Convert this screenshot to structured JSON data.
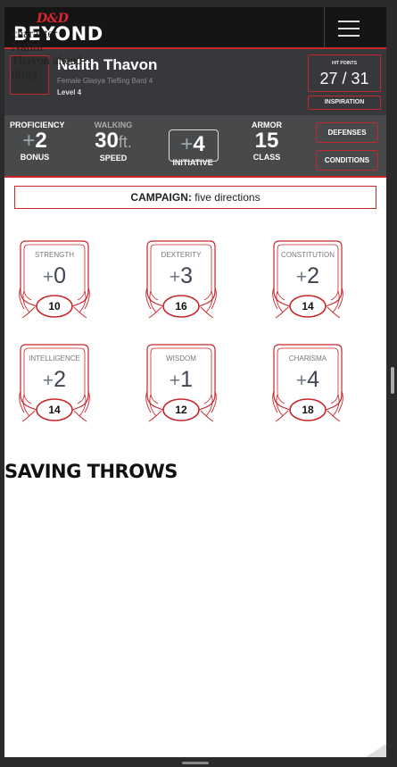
{
  "brand": {
    "logo_top": "D&D",
    "logo_bottom": "BEYOND"
  },
  "menu": {
    "icon": "hamburger-menu-icon"
  },
  "character": {
    "avatar_alt": "character Nalith Thavon ahead thing",
    "name": "Nalith Thavon",
    "subtitle": "Female Glasya Tiefling Bard 4",
    "level": "Level 4"
  },
  "hit_points": {
    "label": "HIT POINTS",
    "current": "27",
    "max": "31",
    "display": "27 / 31"
  },
  "inspiration": {
    "label": "INSPIRATION"
  },
  "stats": {
    "proficiency": {
      "top": "PROFICIENCY",
      "sign": "+",
      "value": "2",
      "bottom": "BONUS"
    },
    "speed": {
      "top": "WALKING",
      "value": "30",
      "unit": "ft.",
      "bottom": "SPEED"
    },
    "initiative": {
      "sign": "+",
      "value": "4",
      "bottom": "INITIATIVE"
    },
    "armor": {
      "top": "ARMOR",
      "value": "15",
      "bottom": "CLASS"
    }
  },
  "buttons": {
    "defenses": "DEFENSES",
    "conditions": "CONDITIONS"
  },
  "campaign": {
    "label": "CAMPAIGN:",
    "name": "five directions"
  },
  "abilities": [
    {
      "label": "STRENGTH",
      "sign": "+",
      "mod": "0",
      "score": "10"
    },
    {
      "label": "DEXTERITY",
      "sign": "+",
      "mod": "3",
      "score": "16"
    },
    {
      "label": "CONSTITUTION",
      "sign": "+",
      "mod": "2",
      "score": "14"
    },
    {
      "label": "INTELLIGENCE",
      "sign": "+",
      "mod": "2",
      "score": "14"
    },
    {
      "label": "WISDOM",
      "sign": "+",
      "mod": "1",
      "score": "12"
    },
    {
      "label": "CHARISMA",
      "sign": "+",
      "mod": "4",
      "score": "18"
    }
  ],
  "saving_throws": {
    "heading": "SAVING THROWS"
  },
  "colors": {
    "accent": "#c8262a",
    "brand_red": "#e0242f",
    "header_bg": "#36383b",
    "stat_bg": "#48494b"
  }
}
